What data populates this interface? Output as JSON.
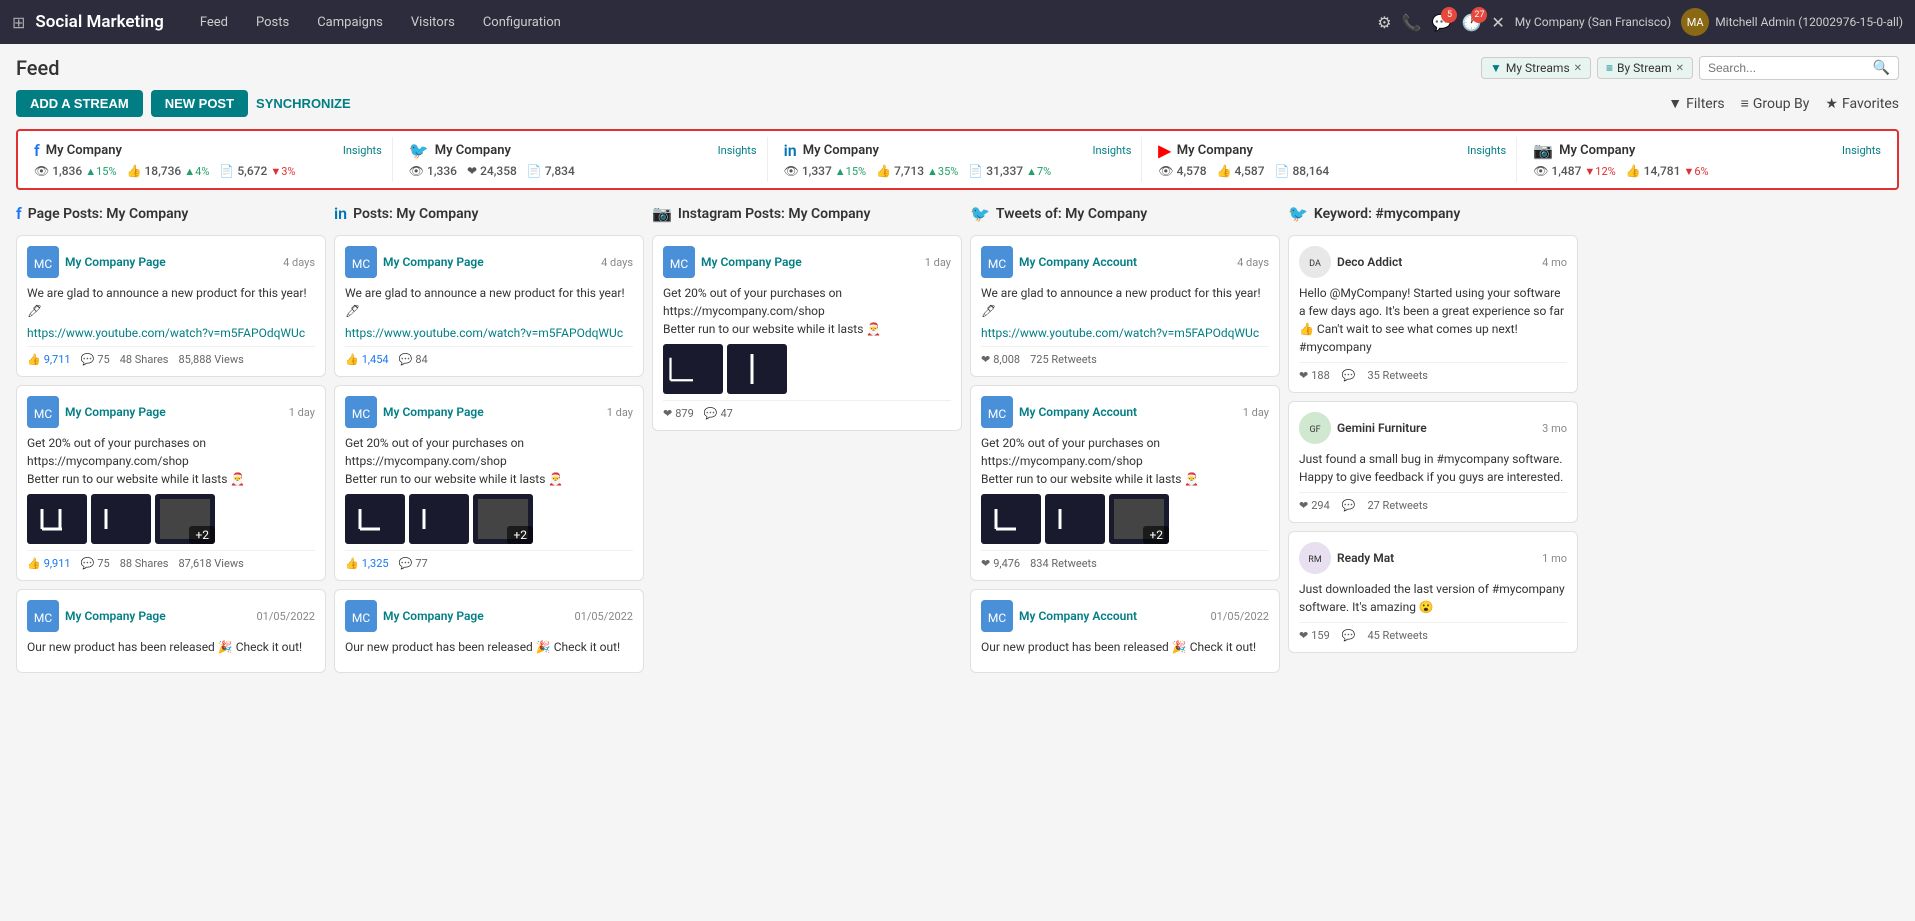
{
  "app": {
    "brand": "Social Marketing",
    "nav_links": [
      "Feed",
      "Posts",
      "Campaigns",
      "Visitors",
      "Configuration"
    ],
    "notifications": {
      "chat": 5,
      "clock": 27
    },
    "company": "My Company (San Francisco)",
    "user": "Mitchell Admin (12002976-15-0-all)"
  },
  "feed": {
    "title": "Feed",
    "filters": [
      {
        "label": "My Streams",
        "icon": "▼"
      },
      {
        "label": "By Stream",
        "icon": "≡"
      }
    ],
    "search_placeholder": "Search...",
    "actions": {
      "add_stream": "ADD A STREAM",
      "new_post": "NEW POST",
      "sync": "SYNCHRONIZE",
      "filters": "Filters",
      "group_by": "Group By",
      "favorites": "Favorites"
    }
  },
  "stats": [
    {
      "platform": "Facebook",
      "icon": "fb",
      "name": "My Company",
      "insights": "Insights",
      "metrics": [
        {
          "icon": "👁",
          "value": "1,836",
          "change": "+15%",
          "dir": "up"
        },
        {
          "icon": "👍",
          "value": "18,736",
          "change": "+4%",
          "dir": "up"
        },
        {
          "icon": "📄",
          "value": "5,672",
          "change": "-3%",
          "dir": "down"
        }
      ]
    },
    {
      "platform": "Twitter",
      "icon": "tw",
      "name": "My Company",
      "insights": "Insights",
      "metrics": [
        {
          "icon": "👁",
          "value": "1,336",
          "change": "",
          "dir": ""
        },
        {
          "icon": "❤",
          "value": "24,358",
          "change": "",
          "dir": ""
        },
        {
          "icon": "📄",
          "value": "7,834",
          "change": "",
          "dir": ""
        }
      ]
    },
    {
      "platform": "LinkedIn",
      "icon": "li",
      "name": "My Company",
      "insights": "Insights",
      "metrics": [
        {
          "icon": "👁",
          "value": "1,337",
          "change": "+15%",
          "dir": "up"
        },
        {
          "icon": "👍",
          "value": "7,713",
          "change": "+35%",
          "dir": "up"
        },
        {
          "icon": "📄",
          "value": "31,337",
          "change": "+7%",
          "dir": "up"
        }
      ]
    },
    {
      "platform": "YouTube",
      "icon": "yt",
      "name": "My Company",
      "insights": "Insights",
      "metrics": [
        {
          "icon": "👁",
          "value": "4,578",
          "change": "",
          "dir": ""
        },
        {
          "icon": "👍",
          "value": "4,587",
          "change": "",
          "dir": ""
        },
        {
          "icon": "📄",
          "value": "88,164",
          "change": "",
          "dir": ""
        }
      ]
    },
    {
      "platform": "Instagram",
      "icon": "ig",
      "name": "My Company",
      "insights": "Insights",
      "metrics": [
        {
          "icon": "👁",
          "value": "1,487",
          "change": "-12%",
          "dir": "down"
        },
        {
          "icon": "👍",
          "value": "14,781",
          "change": "-6%",
          "dir": "down"
        }
      ]
    }
  ],
  "columns": [
    {
      "id": "fb-page",
      "platform": "fb",
      "title": "Page Posts: My Company",
      "posts": [
        {
          "author": "My Company Page",
          "time": "4 days",
          "text": "We are glad to announce a new product for this year! 🖊",
          "link": "https://www.youtube.com/watch?v=m5FAPOdqWUc",
          "images": true,
          "image_count": 0,
          "likes": "9,711",
          "comments": "75",
          "shares": "48 Shares",
          "views": "85,888 Views"
        },
        {
          "author": "My Company Page",
          "time": "1 day",
          "text": "Get 20% out of your purchases on https://mycompany.com/shop\nBetter run to our website while it lasts 🎅",
          "link": "",
          "images": true,
          "image_count": 2,
          "likes": "9,911",
          "comments": "75",
          "shares": "88 Shares",
          "views": "87,618 Views"
        },
        {
          "author": "My Company Page",
          "time": "01/05/2022",
          "text": "Our new product has been released 🎉 Check it out!",
          "link": "",
          "images": false,
          "image_count": 0,
          "likes": "",
          "comments": "",
          "shares": "",
          "views": ""
        }
      ]
    },
    {
      "id": "li-posts",
      "platform": "li",
      "title": "Posts: My Company",
      "posts": [
        {
          "author": "My Company Page",
          "time": "4 days",
          "text": "We are glad to announce a new product for this year! 🖊",
          "link": "https://www.youtube.com/watch?v=m5FAPOdqWUc",
          "images": false,
          "image_count": 0,
          "likes": "1,454",
          "comments": "84",
          "shares": "",
          "views": ""
        },
        {
          "author": "My Company Page",
          "time": "1 day",
          "text": "Get 20% out of your purchases on https://mycompany.com/shop\nBetter run to our website while it lasts 🎅",
          "link": "",
          "images": true,
          "image_count": 2,
          "likes": "1,325",
          "comments": "77",
          "shares": "",
          "views": ""
        },
        {
          "author": "My Company Page",
          "time": "01/05/2022",
          "text": "Our new product has been released 🎉 Check it out!",
          "link": "",
          "images": false,
          "image_count": 0,
          "likes": "",
          "comments": "",
          "shares": "",
          "views": ""
        }
      ]
    },
    {
      "id": "ig-posts",
      "platform": "ig",
      "title": "Instagram Posts: My Company",
      "posts": [
        {
          "author": "My Company Page",
          "time": "1 day",
          "text": "Get 20% out of your purchases on https://mycompany.com/shop\nBetter run to our website while it lasts 🎅",
          "link": "",
          "images": true,
          "image_count": 0,
          "likes": "879",
          "comments": "47",
          "shares": "",
          "views": ""
        }
      ]
    },
    {
      "id": "tw-tweets",
      "platform": "tw",
      "title": "Tweets of: My Company",
      "posts": [
        {
          "author": "My Company Account",
          "time": "4 days",
          "text": "We are glad to announce a new product for this year! 🖊",
          "link": "https://www.youtube.com/watch?v=m5FAPOdqWUc",
          "images": false,
          "image_count": 0,
          "likes": "8,008",
          "comments": "",
          "shares": "725 Retweets",
          "views": ""
        },
        {
          "author": "My Company Account",
          "time": "1 day",
          "text": "Get 20% out of your purchases on https://mycompany.com/shop\nBetter run to our website while it lasts 🎅",
          "link": "",
          "images": true,
          "image_count": 2,
          "likes": "9,476",
          "comments": "",
          "shares": "834 Retweets",
          "views": ""
        },
        {
          "author": "My Company Account",
          "time": "01/05/2022",
          "text": "Our new product has been released 🎉 Check it out!",
          "link": "",
          "images": false,
          "image_count": 0,
          "likes": "",
          "comments": "",
          "shares": "",
          "views": ""
        }
      ]
    }
  ],
  "keyword_col": {
    "title": "Keyword: #mycompany",
    "platform": "tw",
    "tweets": [
      {
        "author": "Deco Addict",
        "time": "4 mo",
        "text": "Hello @MyCompany! Started using your software a few days ago. It's been a great experience so far 👍 Can't wait to see what comes up next! #mycompany",
        "likes": "188",
        "comments": "",
        "retweets": "35 Retweets"
      },
      {
        "author": "Gemini Furniture",
        "time": "3 mo",
        "text": "Just found a small bug in #mycompany software. Happy to give feedback if you guys are interested.",
        "likes": "294",
        "comments": "",
        "retweets": "27 Retweets"
      },
      {
        "author": "Ready Mat",
        "time": "1 mo",
        "text": "Just downloaded the last version of #mycompany software. It's amazing 😮",
        "likes": "159",
        "comments": "",
        "retweets": "45 Retweets"
      }
    ]
  }
}
